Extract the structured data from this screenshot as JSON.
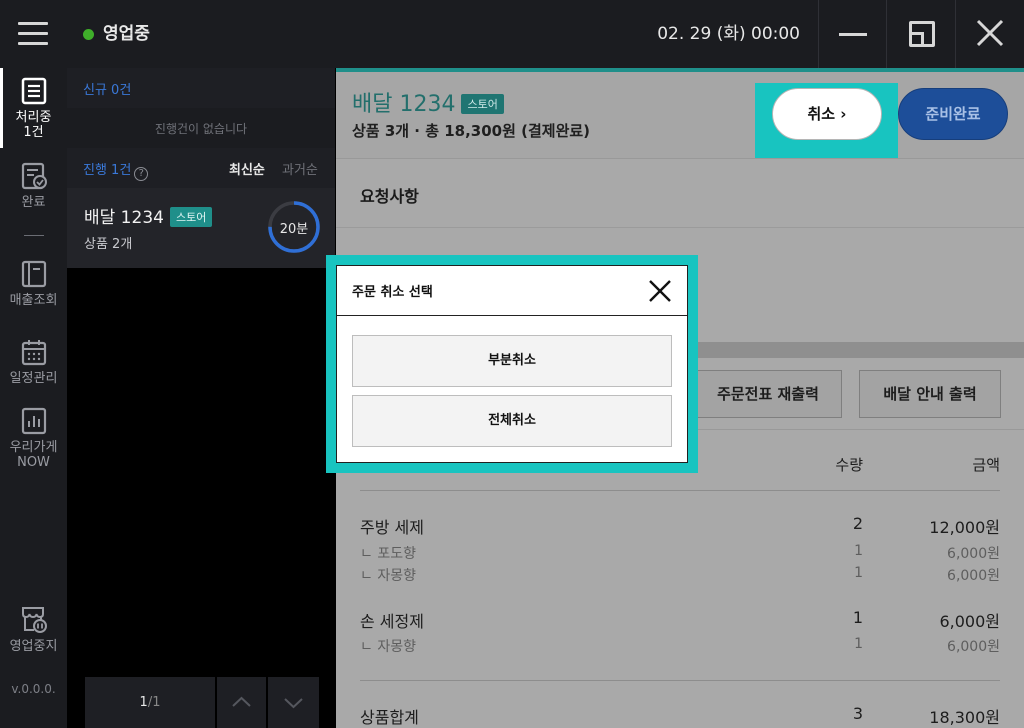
{
  "topbar": {
    "status": "영업중",
    "datetime": "02. 29 (화) 00:00",
    "colors": {
      "status_dot": "#3fae2a",
      "bar_bg": "#1b1c20"
    }
  },
  "sidebar": {
    "items": [
      {
        "label": "처리중",
        "sub": "1건"
      },
      {
        "label": "완료"
      },
      {
        "label": "매출조회"
      },
      {
        "label": "일정관리"
      },
      {
        "label": "우리가게",
        "sub": "NOW"
      },
      {
        "label": "영업중지"
      }
    ],
    "version": "v.0.0.0."
  },
  "list": {
    "new_label": "신규 0건",
    "empty_text": "진행건이 없습니다",
    "progress_label": "진행 1건",
    "help_glyph": "?",
    "sort_newest": "최신순",
    "sort_oldest": "과거순",
    "order": {
      "title": "배달 1234",
      "badge": "스토어",
      "sub": "상품 2개",
      "timer": "20분",
      "timer_fraction": 0.75
    },
    "pager": {
      "current": "1",
      "total": "/1"
    }
  },
  "detail": {
    "title": "배달 1234",
    "badge": "스토어",
    "summary": "상품 3개 · 총 18,300원 (결제완료)",
    "cancel_label": "취소 ›",
    "ready_label": "준비완료",
    "request_title": "요청사항",
    "print_order": "주문전표 재출력",
    "print_delivery": "배달 안내 출력",
    "table": {
      "qty_header": "수량",
      "amount_header": "금액",
      "items": [
        {
          "name": "주방 세제",
          "qty": "2",
          "amount": "12,000원",
          "options": [
            {
              "name": "ㄴ 포도향",
              "qty": "1",
              "amount": "6,000원"
            },
            {
              "name": "ㄴ 자몽향",
              "qty": "1",
              "amount": "6,000원"
            }
          ]
        },
        {
          "name": "손 세정제",
          "qty": "1",
          "amount": "6,000원",
          "options": [
            {
              "name": "ㄴ 자몽향",
              "qty": "1",
              "amount": "6,000원"
            }
          ]
        }
      ],
      "total_label": "상품합계",
      "total_qty": "3",
      "total_amount": "18,300원"
    },
    "colors": {
      "accent": "#1f8f8a",
      "highlight": "#18c4c0",
      "ready_btn": "#1d4e99"
    }
  },
  "modal": {
    "title": "주문 취소 선택",
    "partial_cancel": "부분취소",
    "full_cancel": "전체취소"
  }
}
